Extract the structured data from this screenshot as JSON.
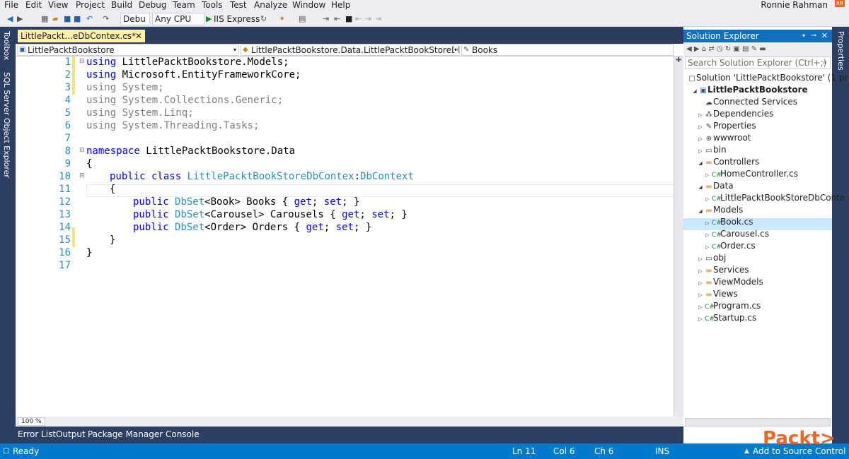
{
  "menu": [
    "File",
    "Edit",
    "View",
    "Project",
    "Build",
    "Debug",
    "Team",
    "Tools",
    "Test",
    "Analyze",
    "Window",
    "Help"
  ],
  "user": {
    "name": "Ronnie Rahman",
    "icon": "user-icon",
    "icon_text": "RR"
  },
  "toolbar": {
    "config": "Debu",
    "platform": "Any CPU",
    "run": "IIS Express"
  },
  "left_strip": {
    "toolbox": "Toolbox",
    "sql": "SQL Server Object Explorer"
  },
  "right_strip": {
    "properties": "Properties"
  },
  "doc_tab": {
    "label": "LittlePackt...eDbContex.cs*"
  },
  "nav": {
    "project": "LittlePacktBookstore",
    "type": "LittlePacktBookstore.Data.LittlePacktBookStoreDbConte",
    "member": "Books"
  },
  "code": {
    "line_numbers": [
      "1",
      "2",
      "3",
      "4",
      "5",
      "6",
      "7",
      "8",
      "9",
      "10",
      "11",
      "12",
      "13",
      "14",
      "15",
      "16",
      "17"
    ],
    "l1_kw": "using",
    "l1_rest": " LittlePacktBookstore.Models;",
    "l2_kw": "using",
    "l2_rest": " Microsoft.EntityFrameworkCore;",
    "l3": "using System;",
    "l4": "using System.Collections.Generic;",
    "l5": "using System.Linq;",
    "l6": "using System.Threading.Tasks;",
    "l8_kw": "namespace",
    "l8_rest": " LittlePacktBookstore.Data",
    "brace_open": "{",
    "l10_kw": "public class ",
    "l10_type": "LittlePacktBookStoreDbContex",
    "l10_sep": ":",
    "l10_base": "DbContext",
    "l12_kw": "public ",
    "l12_type": "DbSet",
    "l12_a": "<",
    "l12_t": "Book",
    "l12_b": "> Books { ",
    "l12_get": "get",
    "l12_c": "; ",
    "l12_set": "set",
    "l12_d": "; }",
    "l13_kw": "public ",
    "l13_type": "DbSet",
    "l13_a": "<",
    "l13_t": "Carousel",
    "l13_b": "> Carousels { ",
    "l13_get": "get",
    "l13_c": "; ",
    "l13_set": "set",
    "l13_d": "; }",
    "l14_kw": "public ",
    "l14_type": "DbSet",
    "l14_a": "<",
    "l14_t": "Order",
    "l14_b": "> Orders { ",
    "l14_get": "get",
    "l14_c": "; ",
    "l14_set": "set",
    "l14_d": "; }",
    "brace_close": "}"
  },
  "zoom": "100 %",
  "bottom_tabs": [
    "Error List",
    "Output",
    "Package Manager Console"
  ],
  "solution_explorer": {
    "title": "Solution Explorer",
    "search_placeholder": "Search Solution Explorer (Ctrl+;)",
    "items": [
      {
        "label": "Solution 'LittlePacktBookstore' (1 pr",
        "icon": "solution-icon"
      },
      {
        "label": "LittlePacktBookstore",
        "icon": "project-icon"
      },
      {
        "label": "Connected Services",
        "icon": "connected-services-icon"
      },
      {
        "label": "Dependencies",
        "icon": "dependencies-icon"
      },
      {
        "label": "Properties",
        "icon": "wrench-icon"
      },
      {
        "label": "wwwroot",
        "icon": "globe-icon"
      },
      {
        "label": "bin",
        "icon": "folder-icon"
      },
      {
        "label": "Controllers",
        "icon": "folder-icon"
      },
      {
        "label": "HomeController.cs",
        "icon": "csharp-file-icon"
      },
      {
        "label": "Data",
        "icon": "folder-icon"
      },
      {
        "label": "LittlePacktBookStoreDbConte",
        "icon": "csharp-file-icon"
      },
      {
        "label": "Models",
        "icon": "folder-icon"
      },
      {
        "label": "Book.cs",
        "icon": "csharp-file-icon"
      },
      {
        "label": "Carousel.cs",
        "icon": "csharp-file-icon"
      },
      {
        "label": "Order.cs",
        "icon": "csharp-file-icon"
      },
      {
        "label": "obj",
        "icon": "folder-icon"
      },
      {
        "label": "Services",
        "icon": "folder-icon"
      },
      {
        "label": "ViewModels",
        "icon": "folder-icon"
      },
      {
        "label": "Views",
        "icon": "folder-icon"
      },
      {
        "label": "Program.cs",
        "icon": "csharp-file-icon"
      },
      {
        "label": "Startup.cs",
        "icon": "csharp-file-icon"
      }
    ]
  },
  "status": {
    "ready": "Ready",
    "ln": "Ln 11",
    "col": "Col 6",
    "ch": "Ch 6",
    "ins": "INS",
    "source_control": "Add to Source Control"
  },
  "brand": {
    "name": "Packt>"
  },
  "colors": {
    "status_bar": "#007acc",
    "frame": "#2d3e63",
    "keyword": "#0000ff",
    "type": "#2b91af",
    "brand": "#f26522"
  }
}
